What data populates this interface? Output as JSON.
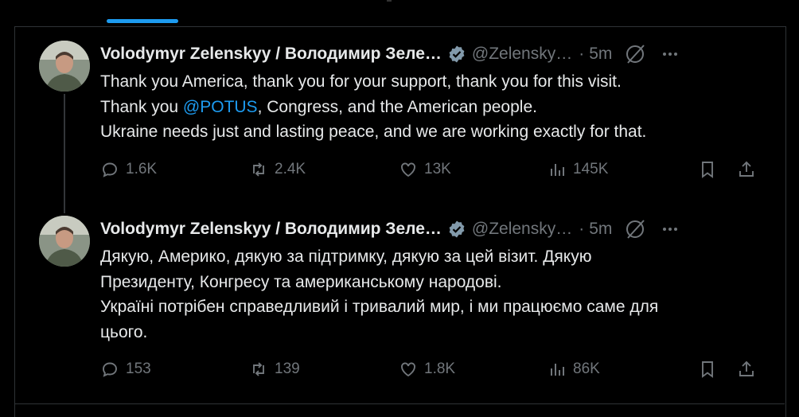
{
  "tweets": [
    {
      "name": "Volodymyr Zelenskyy / Володимир Зеле…",
      "handle": "@Zelensky…",
      "separator": "·",
      "time": "5m",
      "lines": [
        {
          "before": "Thank you America, thank you for your support, thank you for this visit.",
          "mention": "",
          "after": ""
        },
        {
          "before": "Thank you ",
          "mention": "@POTUS",
          "after": ", Congress, and the American people."
        },
        {
          "before": "Ukraine needs just and lasting peace, and we are working exactly for that.",
          "mention": "",
          "after": ""
        }
      ],
      "replies": "1.6K",
      "reposts": "2.4K",
      "likes": "13K",
      "views": "145K"
    },
    {
      "name": "Volodymyr Zelenskyy / Володимир Зеле…",
      "handle": "@Zelensky…",
      "separator": "·",
      "time": "5m",
      "lines": [
        {
          "before": "Дякую, Америко, дякую за підтримку, дякую за цей візит. Дякую",
          "mention": "",
          "after": ""
        },
        {
          "before": "Президенту, Конгресу та американському народові.",
          "mention": "",
          "after": ""
        },
        {
          "before": "Україні потрібен справедливий і тривалий мир, і ми працюємо саме для",
          "mention": "",
          "after": ""
        },
        {
          "before": "цього.",
          "mention": "",
          "after": ""
        }
      ],
      "replies": "153",
      "reposts": "139",
      "likes": "1.8K",
      "views": "86K"
    }
  ],
  "icons": {
    "verified": "verified-badge-icon",
    "grok": "grok-icon",
    "more": "more-icon",
    "reply": "reply-icon",
    "repost": "repost-icon",
    "like": "like-icon",
    "views": "views-icon",
    "bookmark": "bookmark-icon",
    "share": "share-icon"
  },
  "colors": {
    "background": "#000000",
    "text": "#e7e9ea",
    "muted": "#71767b",
    "accent": "#1d9bf0",
    "border": "#2f3336"
  }
}
